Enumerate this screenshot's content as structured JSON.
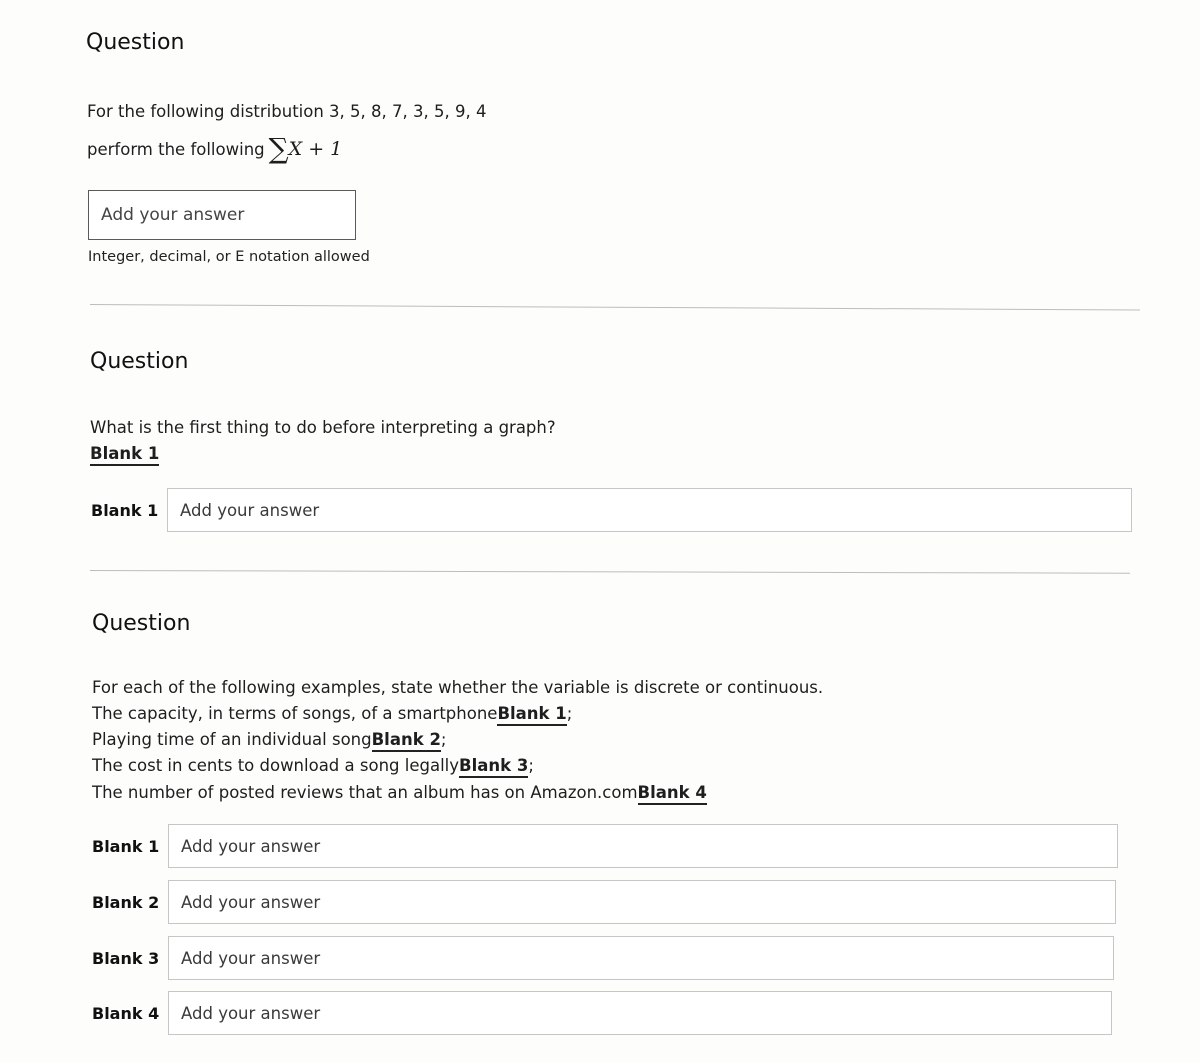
{
  "questions": [
    {
      "title": "Question",
      "prompt_line1": "For the following distribution 3, 5, 8, 7, 3, 5, 9, 4",
      "prompt_line2": "perform the following",
      "formula_symbol": "∑",
      "formula_text": "X + 1",
      "answer_placeholder": "Add your answer",
      "answer_value": "",
      "hint": "Integer, decimal, or E notation allowed"
    },
    {
      "title": "Question",
      "prompt": "What is the first thing to do before interpreting a graph?",
      "blank_ref": "Blank 1",
      "blanks": [
        {
          "label": "Blank 1",
          "placeholder": "Add your answer",
          "value": ""
        }
      ]
    },
    {
      "title": "Question",
      "prompt": "For each of the following examples, state whether the variable is discrete or continuous.",
      "items": [
        {
          "text": "The capacity, in terms of songs, of a smartphone",
          "blank_ref": "Blank 1",
          "suffix": ";"
        },
        {
          "text": "Playing time of an individual song",
          "blank_ref": "Blank 2",
          "suffix": ";"
        },
        {
          "text": "The cost in cents to download a song legally",
          "blank_ref": "Blank 3",
          "suffix": ";"
        },
        {
          "text": "The number of posted reviews that an album has on Amazon.com",
          "blank_ref": "Blank 4",
          "suffix": ""
        }
      ],
      "blanks": [
        {
          "label": "Blank 1",
          "placeholder": "Add your answer",
          "value": ""
        },
        {
          "label": "Blank 2",
          "placeholder": "Add your answer",
          "value": ""
        },
        {
          "label": "Blank 3",
          "placeholder": "Add your answer",
          "value": ""
        },
        {
          "label": "Blank 4",
          "placeholder": "Add your answer",
          "value": ""
        }
      ]
    }
  ]
}
